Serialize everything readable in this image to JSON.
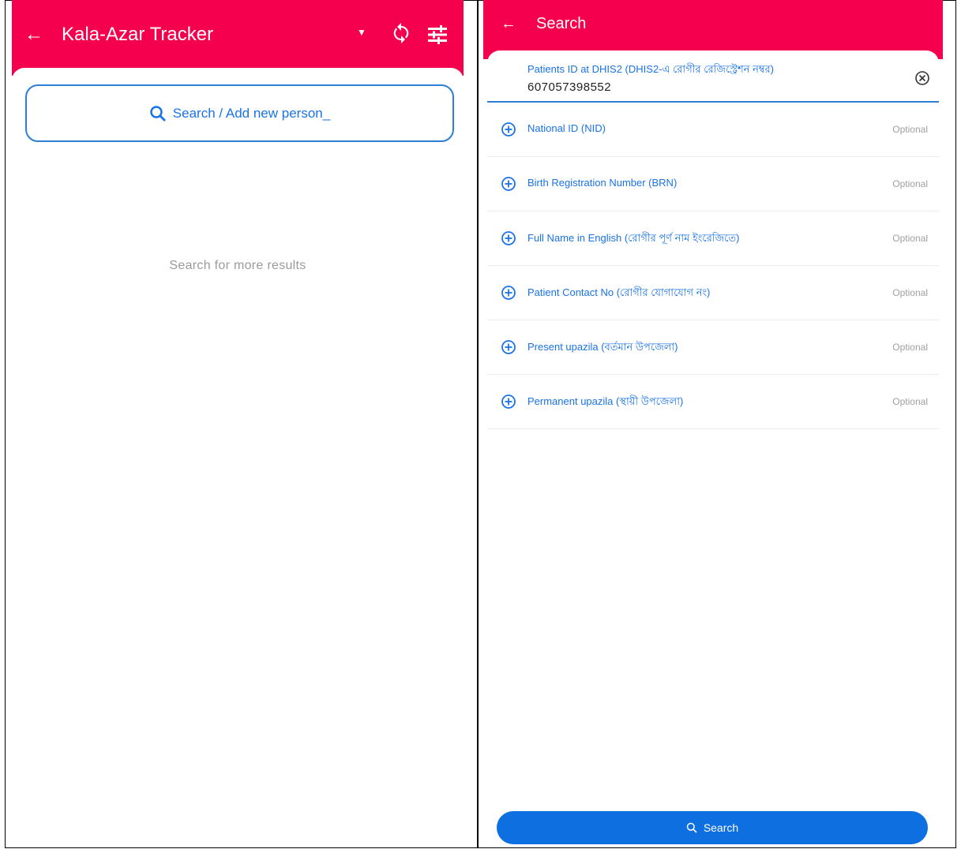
{
  "left": {
    "appbar": {
      "back_glyph": "←",
      "title": "Kala-Azar Tracker",
      "dropdown_glyph": "▼",
      "sync_icon": "sync-icon",
      "filter_icon": "filter-icon"
    },
    "search_label": "Search / Add new person_",
    "empty_text": "Search for more results"
  },
  "right": {
    "appbar": {
      "back_glyph": "←",
      "title": "Search"
    },
    "id_field": {
      "label": "Patients ID at DHIS2 (DHIS2-এ রোগীর রেজিস্ট্রেশন নম্বর)",
      "value": "607057398552"
    },
    "fields": [
      {
        "label": "National ID (NID)",
        "optional": "Optional"
      },
      {
        "label": "Birth Registration Number (BRN)",
        "optional": "Optional"
      },
      {
        "label": "Full Name in English (রোগীর পূর্ণ নাম ইংরেজিতে)",
        "optional": "Optional"
      },
      {
        "label": "Patient Contact No (রোগীর যোগাযোগ নং)",
        "optional": "Optional"
      },
      {
        "label": "Present upazila (বর্তমান উপজেলা)",
        "optional": "Optional"
      },
      {
        "label": "Permanent upazila (স্থায়ী উপজেলা)",
        "optional": "Optional"
      }
    ],
    "search_button": "Search"
  },
  "colors": {
    "appbar": "#f5004f",
    "accent": "#1a73e8",
    "button": "#0d6fe0"
  }
}
